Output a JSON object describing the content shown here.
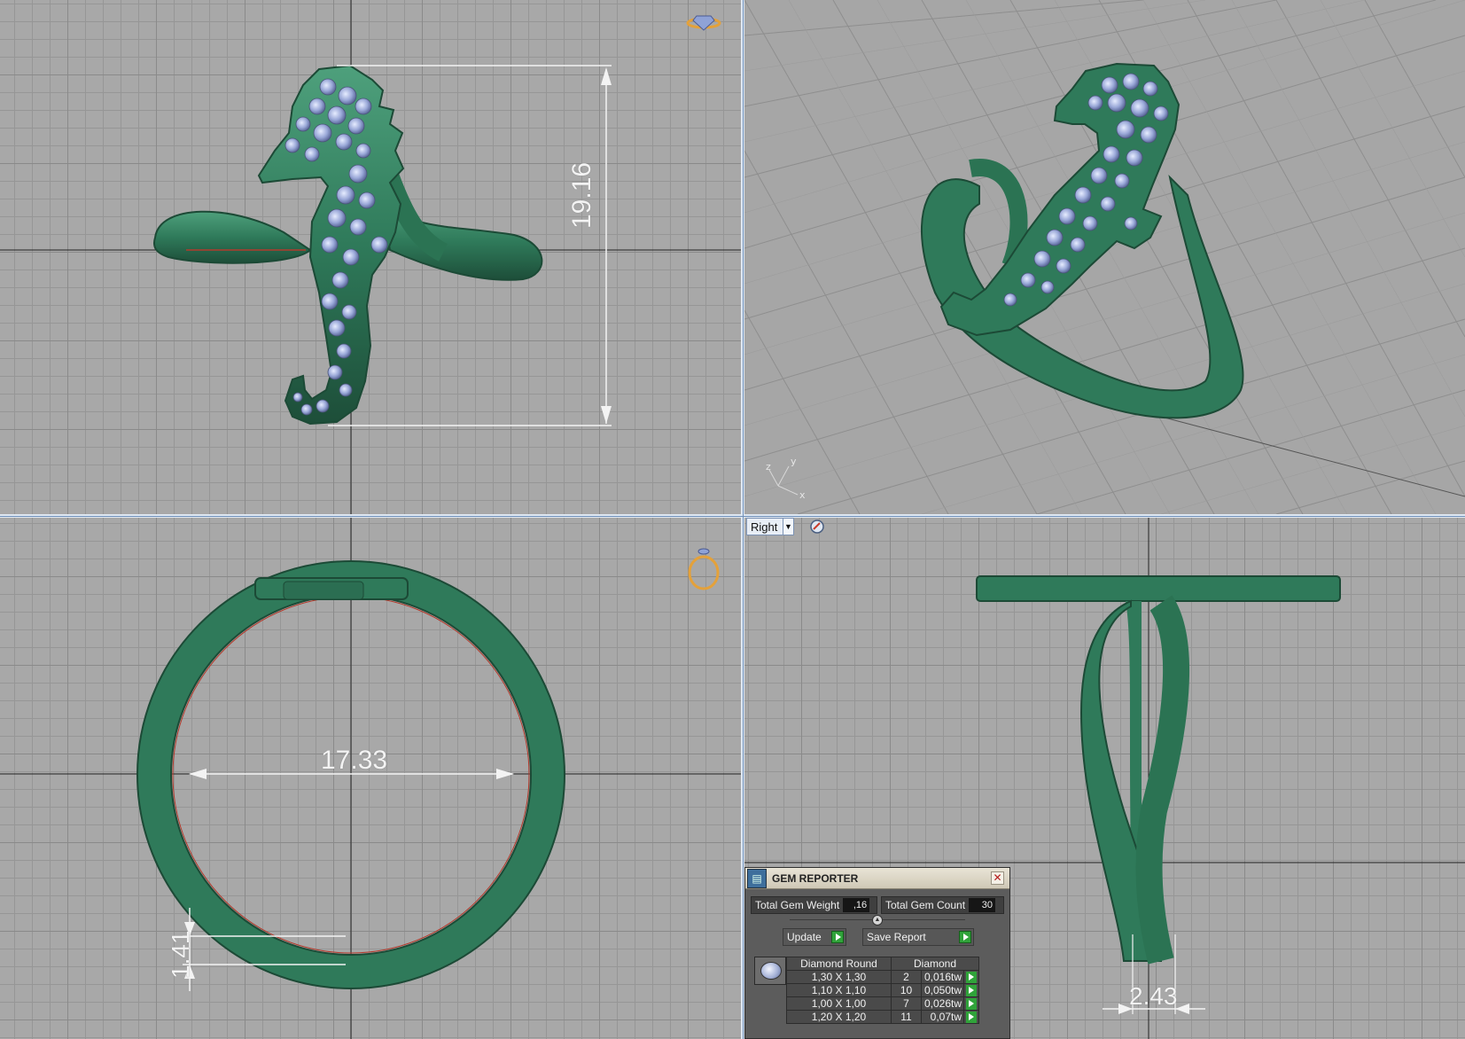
{
  "viewports": {
    "top": {
      "dimension_height": "19.16"
    },
    "front": {
      "dimension_inner_diameter": "17.33",
      "dimension_thickness": "1.41"
    },
    "right": {
      "view_label": "Right",
      "dimension_width": "2.43"
    },
    "perspective": {
      "axis_labels": [
        "z",
        "y",
        "x"
      ]
    }
  },
  "colors": {
    "metal": "#2f7a5a",
    "gem": "#9aa8d8",
    "grid_bg": "#a8a8a8",
    "dimension_line": "#f3f3f3",
    "accent_go": "#30a33a"
  },
  "gem_reporter": {
    "title": "GEM REPORTER",
    "close_icon": "close-icon",
    "total_gem_weight_label": "Total Gem Weight",
    "total_gem_weight_value": ",16",
    "total_gem_count_label": "Total Gem Count",
    "total_gem_count_value": "30",
    "update_label": "Update",
    "save_report_label": "Save Report",
    "table": {
      "col_shape": "Diamond Round",
      "col_material": "Diamond",
      "rows": [
        {
          "size": "1,30 X 1,30",
          "count": "2",
          "weight": "0,016tw"
        },
        {
          "size": "1,10 X 1,10",
          "count": "10",
          "weight": "0,050tw"
        },
        {
          "size": "1,00 X 1,00",
          "count": "7",
          "weight": "0,026tw"
        },
        {
          "size": "1,20 X 1,20",
          "count": "11",
          "weight": "0,07tw"
        }
      ]
    }
  }
}
